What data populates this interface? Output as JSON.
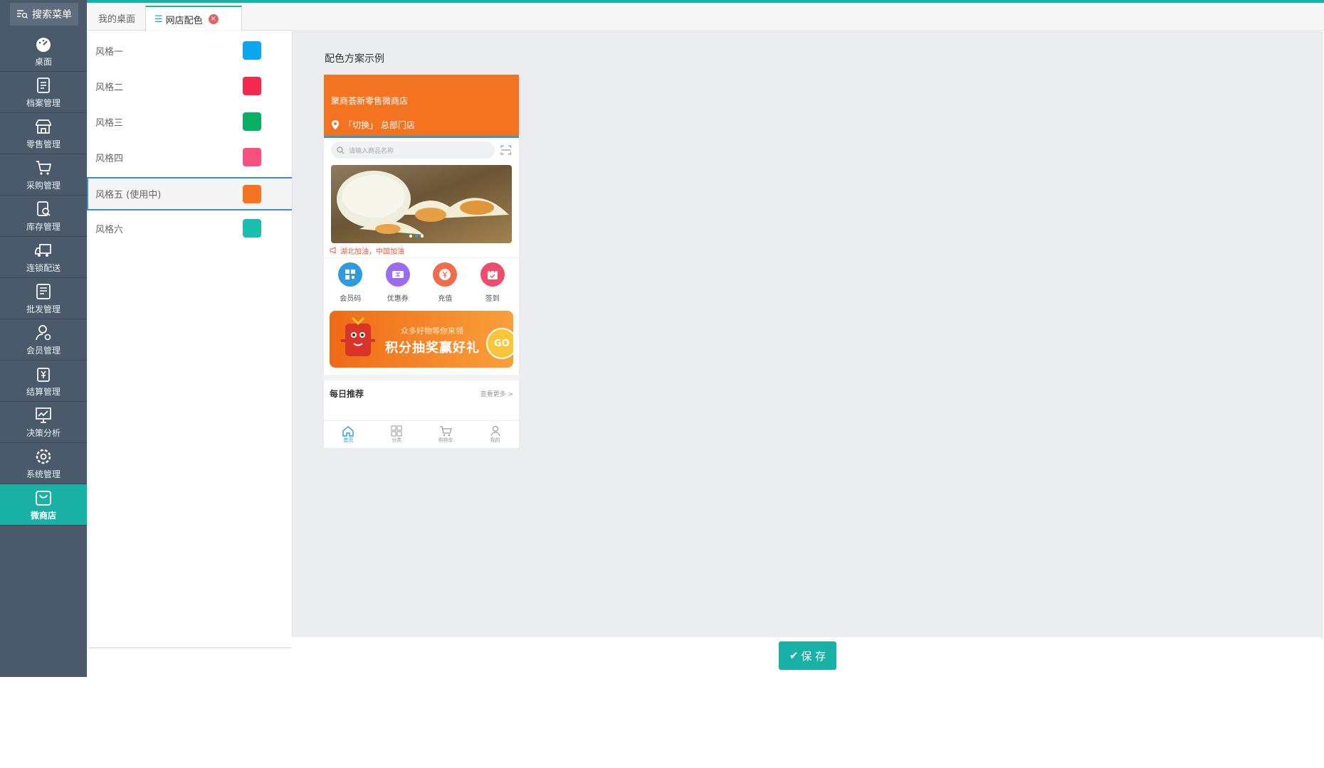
{
  "sidebar": {
    "search_label": "搜索菜单",
    "items": [
      {
        "label": "桌面",
        "icon": "dashboard-icon"
      },
      {
        "label": "档案管理",
        "icon": "archive-icon"
      },
      {
        "label": "零售管理",
        "icon": "store-icon"
      },
      {
        "label": "采购管理",
        "icon": "cart-icon"
      },
      {
        "label": "库存管理",
        "icon": "inventory-icon"
      },
      {
        "label": "连锁配送",
        "icon": "truck-icon"
      },
      {
        "label": "批发管理",
        "icon": "wholesale-icon"
      },
      {
        "label": "会员管理",
        "icon": "member-icon"
      },
      {
        "label": "结算管理",
        "icon": "settlement-icon"
      },
      {
        "label": "决策分析",
        "icon": "chart-icon"
      },
      {
        "label": "系统管理",
        "icon": "gear-icon"
      },
      {
        "label": "微商店",
        "icon": "shop-bag-icon",
        "active": true
      }
    ]
  },
  "tabs": {
    "desk": "我的桌面",
    "active": "网店配色"
  },
  "styles": [
    {
      "label": "风格一",
      "color": "#0aa6f0"
    },
    {
      "label": "风格二",
      "color": "#f5294e"
    },
    {
      "label": "风格三",
      "color": "#07b161"
    },
    {
      "label": "风格四",
      "color": "#f8507f"
    },
    {
      "label": "风格五 (使用中)",
      "color": "#f57421",
      "active": true
    },
    {
      "label": "风格六",
      "color": "#1bbfb0"
    }
  ],
  "preview": {
    "title": "配色方案示例",
    "shop_name": "聚商荟新零售微商店",
    "store_line": "「切换」 总部门店",
    "search_placeholder": "请输入商品名称",
    "notice": "湖北加油，中国加油",
    "icons": [
      {
        "label": "会员码",
        "color": "#2f9ae0"
      },
      {
        "label": "优惠券",
        "color": "#9b6cf0"
      },
      {
        "label": "充值",
        "color": "#f26b4a"
      },
      {
        "label": "签到",
        "color": "#f04c6c"
      }
    ],
    "promo_sub": "众多好物等你来领",
    "promo_main": "积分抽奖赢好礼",
    "promo_go": "GO",
    "daily_title": "每日推荐",
    "daily_more": "查看更多 >",
    "bottom_tabs": [
      "首页",
      "分类",
      "购物车",
      "我的"
    ]
  },
  "save_label": "保 存"
}
